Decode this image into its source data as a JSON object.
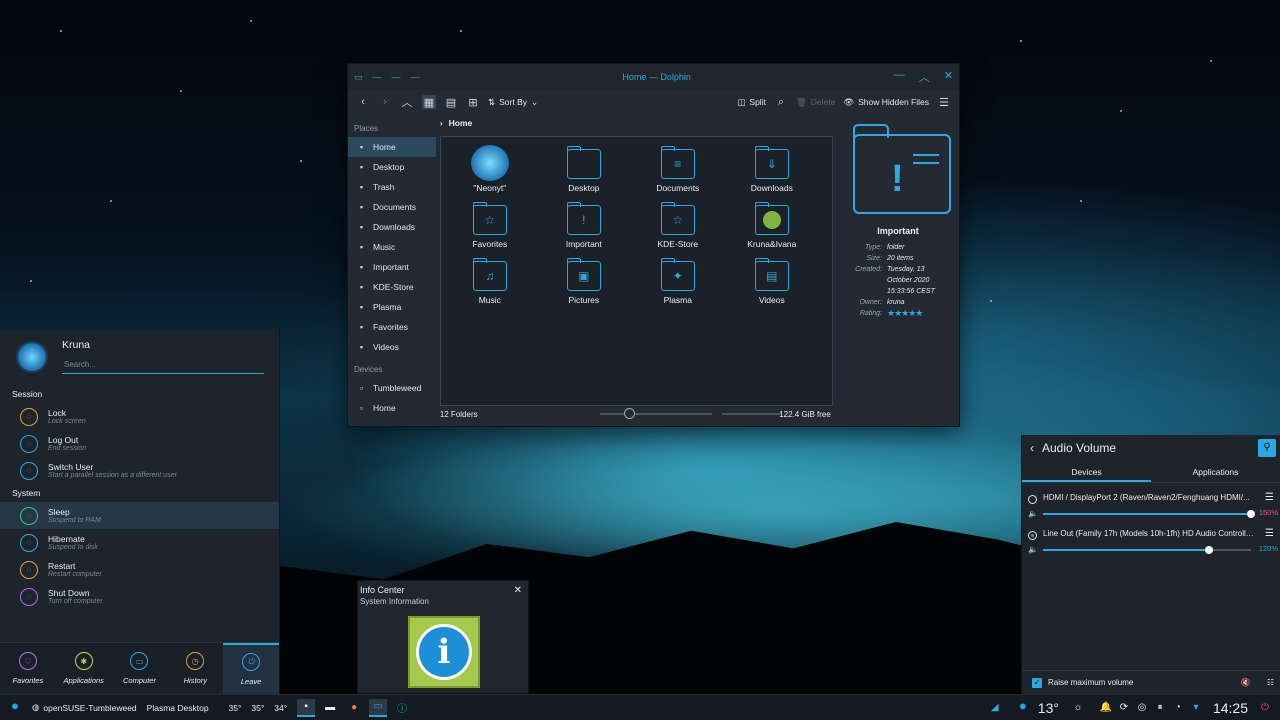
{
  "colors": {
    "accent": "#2ea8e0",
    "panel": "#232a33",
    "alert": "#ff4a8a"
  },
  "dolphin": {
    "title": "Home — Dolphin",
    "toolbar": {
      "sort_label": "Sort By",
      "split_label": "Split",
      "delete_label": "Delete",
      "hidden_label": "Show Hidden Files"
    },
    "places_header": "Places",
    "places": [
      {
        "label": "Home",
        "icon": "home-icon"
      },
      {
        "label": "Desktop",
        "icon": "desktop-icon"
      },
      {
        "label": "Trash",
        "icon": "trash-icon"
      },
      {
        "label": "Documents",
        "icon": "documents-icon"
      },
      {
        "label": "Downloads",
        "icon": "downloads-icon"
      },
      {
        "label": "Music",
        "icon": "music-icon"
      },
      {
        "label": "Important",
        "icon": "important-icon"
      },
      {
        "label": "KDE-Store",
        "icon": "star-icon"
      },
      {
        "label": "Plasma",
        "icon": "plasma-icon"
      },
      {
        "label": "Favorites",
        "icon": "star-icon"
      },
      {
        "label": "Videos",
        "icon": "videos-icon"
      }
    ],
    "devices_header": "Devices",
    "devices": [
      {
        "label": "Tumbleweed",
        "icon": "drive-icon"
      },
      {
        "label": "Home",
        "icon": "drive-icon"
      }
    ],
    "breadcrumb": "Home",
    "files": [
      {
        "label": "\"Neonyt\"",
        "glyph": "",
        "icon": "neonyt-icon"
      },
      {
        "label": "Desktop",
        "glyph": "",
        "icon": "desktop-folder-icon"
      },
      {
        "label": "Documents",
        "glyph": "≡",
        "icon": "documents-folder-icon"
      },
      {
        "label": "Downloads",
        "glyph": "⇓",
        "icon": "downloads-folder-icon"
      },
      {
        "label": "Favorites",
        "glyph": "☆",
        "icon": "favorites-folder-icon"
      },
      {
        "label": "Important",
        "glyph": "!",
        "icon": "important-folder-icon"
      },
      {
        "label": "KDE-Store",
        "glyph": "☆",
        "icon": "kde-store-folder-icon"
      },
      {
        "label": "Kruna&Ivana",
        "glyph": "",
        "icon": "kruna-ivana-folder-icon"
      },
      {
        "label": "Music",
        "glyph": "♫",
        "icon": "music-folder-icon"
      },
      {
        "label": "Pictures",
        "glyph": "▣",
        "icon": "pictures-folder-icon"
      },
      {
        "label": "Plasma",
        "glyph": "✦",
        "icon": "plasma-folder-icon"
      },
      {
        "label": "Videos",
        "glyph": "▤",
        "icon": "videos-folder-icon"
      }
    ],
    "status_text": "12 Folders",
    "free_space": "122.4 GiB free",
    "info": {
      "name": "Important",
      "rows": [
        {
          "k": "Type:",
          "v": "folder"
        },
        {
          "k": "Size:",
          "v": "20 items"
        },
        {
          "k": "Created:",
          "v": "Tuesday, 13 October 2020 15:33:56 CEST"
        },
        {
          "k": "Owner:",
          "v": "kruna"
        },
        {
          "k": "Rating:",
          "v": "★★★★★"
        }
      ]
    }
  },
  "launcher": {
    "user": "Kruna",
    "search_placeholder": "Search...",
    "session_header": "Session",
    "session": [
      {
        "title": "Lock",
        "sub": "Lock screen",
        "icon": "lock-icon"
      },
      {
        "title": "Log Out",
        "sub": "End session",
        "icon": "logout-icon"
      },
      {
        "title": "Switch User",
        "sub": "Start a parallel session as a different user",
        "icon": "switch-user-icon"
      }
    ],
    "system_header": "System",
    "system": [
      {
        "title": "Sleep",
        "sub": "Suspend to RAM",
        "icon": "sleep-icon"
      },
      {
        "title": "Hibernate",
        "sub": "Suspend to disk",
        "icon": "hibernate-icon"
      },
      {
        "title": "Restart",
        "sub": "Restart computer",
        "icon": "restart-icon"
      },
      {
        "title": "Shut Down",
        "sub": "Turn off computer",
        "icon": "shutdown-icon"
      }
    ],
    "tabs": [
      {
        "label": "Favorites",
        "icon": "heart-icon"
      },
      {
        "label": "Applications",
        "icon": "applications-icon"
      },
      {
        "label": "Computer",
        "icon": "computer-icon"
      },
      {
        "label": "History",
        "icon": "history-icon"
      },
      {
        "label": "Leave",
        "icon": "leave-icon"
      }
    ]
  },
  "info_center": {
    "title": "Info Center",
    "subtitle": "System Information",
    "glyph": "i"
  },
  "audio": {
    "title": "Audio Volume",
    "tabs": [
      "Devices",
      "Applications"
    ],
    "devices": [
      {
        "name": "HDMI / DisplayPort 2 (Raven/Raven2/Fenghuang HDMI/...",
        "percent": "150%",
        "level": 1.5,
        "default": false,
        "pct_color": "#ff4a8a"
      },
      {
        "name": "Line Out (Family 17h (Models 10h-1fh) HD Audio Controlle...",
        "percent": "120%",
        "level": 1.2,
        "default": true,
        "pct_color": "#2ea8e0"
      }
    ],
    "footer_label": "Raise maximum volume"
  },
  "taskbar": {
    "window1": "openSUSE-Tumbleweed",
    "window2": "Plasma Desktop",
    "temps": [
      "35°",
      "35°",
      "34°"
    ],
    "weather": "13°",
    "clock": "14:25"
  }
}
